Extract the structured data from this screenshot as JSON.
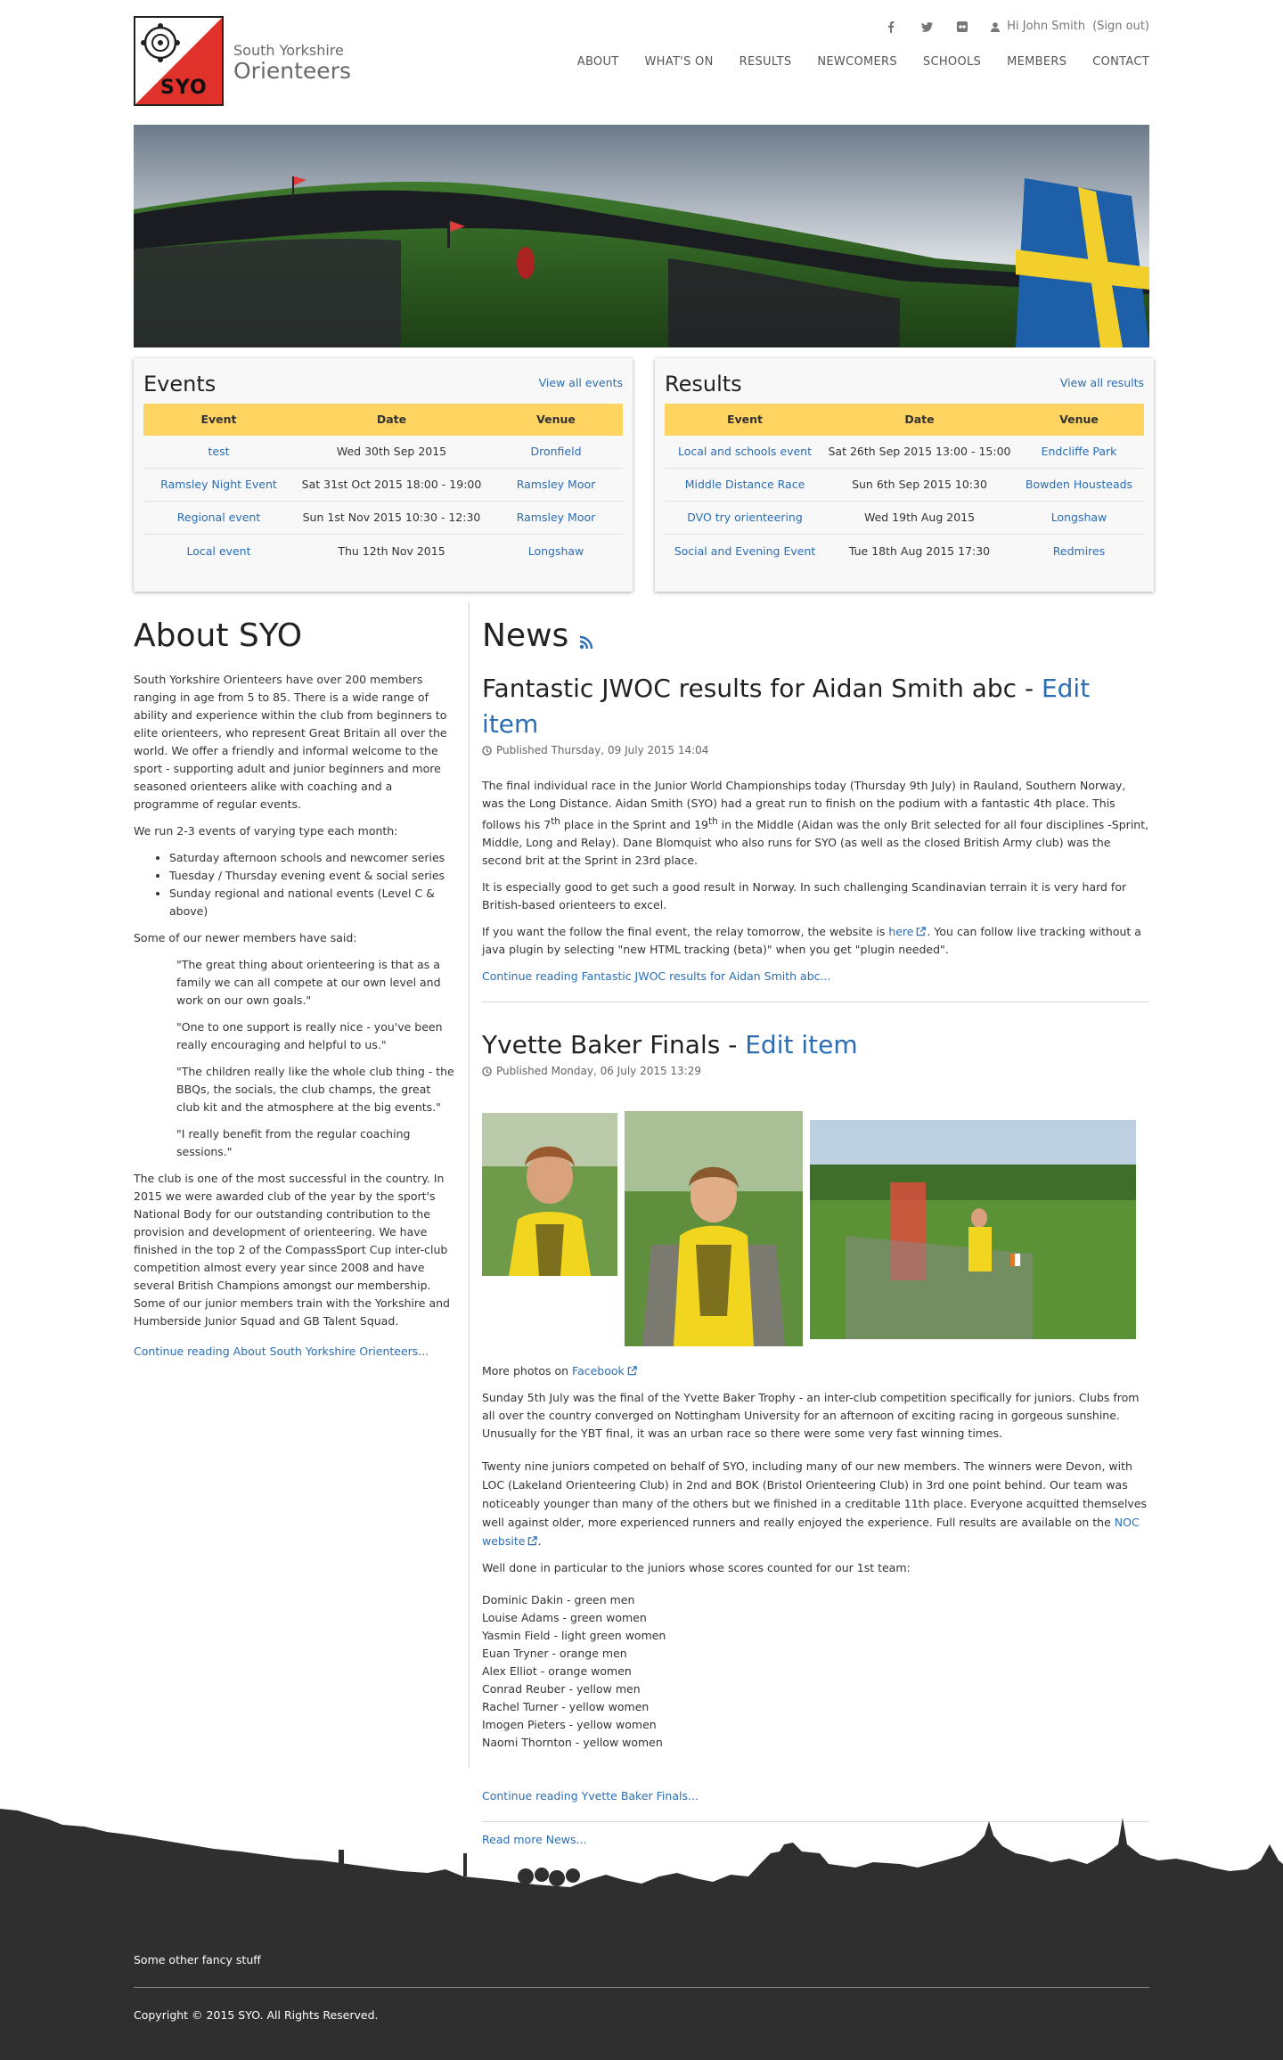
{
  "site": {
    "logo_text": "SYO",
    "brand_line1": "South Yorkshire",
    "brand_line2": "Orienteers",
    "user_greeting": "Hi John Smith",
    "signout_label": "(Sign out)",
    "social": [
      "facebook-icon",
      "twitter-icon",
      "flickr-icon"
    ],
    "accent_color": "#ffd461",
    "link_color": "#2a6db5",
    "logo_red": "#e0312b"
  },
  "nav": [
    "ABOUT",
    "WHAT'S ON",
    "RESULTS",
    "NEWCOMERS",
    "SCHOOLS",
    "MEMBERS",
    "CONTACT"
  ],
  "events": {
    "title": "Events",
    "view_all": "View all events",
    "headers": [
      "Event",
      "Date",
      "Venue"
    ],
    "rows": [
      [
        "test",
        "Wed 30th Sep 2015",
        "Dronfield"
      ],
      [
        "Ramsley Night Event",
        "Sat 31st Oct 2015 18:00 - 19:00",
        "Ramsley Moor"
      ],
      [
        "Regional event",
        "Sun 1st Nov 2015 10:30 - 12:30",
        "Ramsley Moor"
      ],
      [
        "Local event",
        "Thu 12th Nov 2015",
        "Longshaw"
      ]
    ]
  },
  "results": {
    "title": "Results",
    "view_all": "View all results",
    "headers": [
      "Event",
      "Date",
      "Venue"
    ],
    "rows": [
      [
        "Local and schools event",
        "Sat 26th Sep 2015 13:00 - 15:00",
        "Endcliffe Park"
      ],
      [
        "Middle Distance Race",
        "Sun 6th Sep 2015 10:30",
        "Bowden Housteads"
      ],
      [
        "DVO try orienteering",
        "Wed 19th Aug 2015",
        "Longshaw"
      ],
      [
        "Social and Evening Event",
        "Tue 18th Aug 2015 17:30",
        "Redmires"
      ]
    ]
  },
  "about": {
    "title": "About SYO",
    "p1": "South Yorkshire Orienteers have over 200 members ranging in age from 5 to 85. There is a wide range of ability and experience within the club from beginners to elite orienteers, who represent Great Britain all over the world. We offer a friendly and informal welcome to the sport - supporting adult and junior beginners and more seasoned orienteers alike with coaching and a programme of regular events.",
    "p2": "We run 2-3 events of varying type each month:",
    "list": [
      "Saturday afternoon schools and newcomer series",
      "Tuesday / Thursday evening event & social series",
      "Sunday regional and national events (Level C & above)"
    ],
    "p3": "Some of our newer members have said:",
    "quotes": [
      "\"The great thing about orienteering is that as a family we can all compete at our own level and work on our own goals.\"",
      "\"One to one support is really nice - you've been really encouraging and helpful to us.\"",
      "\"The children really like the whole club thing - the BBQs, the socials, the club champs, the great club kit and the atmosphere at the big events.\"",
      "\"I really benefit from the regular coaching sessions.\""
    ],
    "p4": "The club is one of the most successful in the country. In 2015 we were awarded club of the year by the sport's National Body for our outstanding contribution to the provision and development of orienteering.  We have finished in the top 2 of the CompassSport Cup inter-club competition almost every year since 2008 and have several British Champions amongst our membership.  Some of our junior members train with the Yorkshire and Humberside Junior Squad and GB Talent Squad.",
    "continue": "Continue reading About South Yorkshire Orienteers..."
  },
  "news": {
    "title": "News",
    "article1": {
      "title": "Fantastic JWOC results for Aidan Smith abc",
      "separator": " - ",
      "edit": "Edit item",
      "published": "Published Thursday, 09 July 2015 14:04",
      "p1a": "The final individual race in the Junior World Championships today (Thursday 9th July) in Rauland, Southern Norway, was the Long Distance. Aidan Smith (SYO) had a great run to finish on the podium with a fantastic 4th place.  This follows his 7",
      "sup1": "th",
      "p1b": " place in the Sprint and 19",
      "sup2": "th",
      "p1c": " in the Middle (Aidan was the only Brit selected for all four disciplines -Sprint, Middle, Long and Relay). Dane Blomquist who also runs for SYO (as well as the closed British Army club) was the second brit at the Sprint in 23rd place.",
      "p2": "It is especially good to get such a good result in Norway. In such challenging Scandinavian terrain it is very hard for British-based orienteers to excel.",
      "p3a": "If you want the follow the final event, the relay tomorrow, the website is ",
      "p3_link": "here",
      "p3b": ". You can follow live tracking without a java plugin by selecting \"new HTML tracking (beta)\" when you get \"plugin needed\".",
      "continue": "Continue reading Fantastic JWOC results for Aidan Smith abc..."
    },
    "article2": {
      "title": "Yvette Baker Finals",
      "separator": " - ",
      "edit": "Edit item",
      "published": "Published Monday, 06 July 2015 13:29",
      "photos_prefix": "More photos on ",
      "photos_link": "Facebook",
      "p1": "Sunday 5th July was the final of the Yvette Baker Trophy - an inter-club competition specifically for juniors. Clubs from all over the country converged on Nottingham University for an afternoon of exciting racing in gorgeous sunshine. Unusually for the YBT final, it was an urban race so there were some very fast winning times.",
      "p2a": "Twenty nine juniors competed on behalf of SYO, including many of our new members. The winners were Devon, with LOC (Lakeland Orienteering Club) in 2nd and BOK (Bristol Orienteering Club) in 3rd one point behind. Our team was noticeably younger than many of the others but we finished in a creditable 11th place.  Everyone acquitted themselves well against older, more experienced runners and really enjoyed the experience. Full results are available on the ",
      "p2_link": "NOC website",
      "p2b": ".",
      "p3": "Well done in particular to the juniors whose scores counted for our 1st team:",
      "roster": [
        "Dominic Dakin - green men",
        "Louise Adams - green women",
        "Yasmin Field - light green women",
        "Euan Tryner - orange men",
        "Alex Elliot - orange women",
        "Conrad Reuber - yellow men",
        "Rachel Turner - yellow women",
        "Imogen Pieters - yellow women",
        "Naomi Thornton - yellow women"
      ],
      "continue": "Continue reading Yvette Baker Finals..."
    },
    "read_more": "Read more News..."
  },
  "footer": {
    "other": "Some other fancy stuff",
    "copyright": "Copyright © 2015 SYO. All Rights Reserved."
  }
}
